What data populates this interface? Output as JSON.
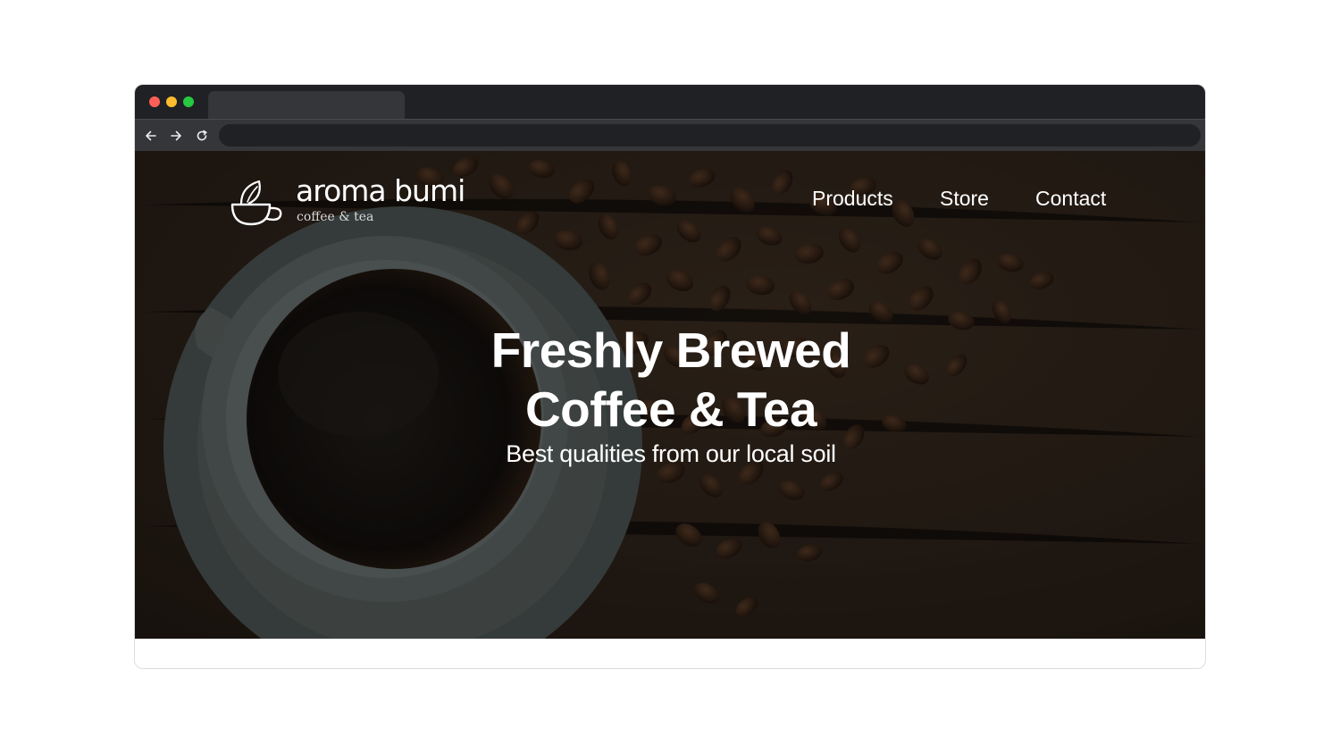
{
  "browser": {
    "window_controls": [
      "close",
      "minimize",
      "maximize"
    ],
    "tab": {
      "title": ""
    },
    "toolbar": {
      "back_icon": "arrow-left-icon",
      "forward_icon": "arrow-right-icon",
      "reload_icon": "reload-icon",
      "address_value": ""
    }
  },
  "site": {
    "logo": {
      "icon": "teacup-leaf-icon",
      "name": "aroma bumi",
      "tagline": "coffee & tea"
    },
    "nav": [
      {
        "label": "Products"
      },
      {
        "label": "Store"
      },
      {
        "label": "Contact"
      }
    ],
    "hero": {
      "title_line1": "Freshly Brewed",
      "title_line2": "Coffee & Tea",
      "subtitle": "Best qualities from our local soil",
      "background": "coffee-cup-and-beans-photo"
    }
  },
  "colors": {
    "titlebar": "#202124",
    "toolbar": "#35363a",
    "hero_text": "#ffffff",
    "close": "#ff5f57",
    "minimize": "#febc2e",
    "maximize": "#28c840"
  }
}
